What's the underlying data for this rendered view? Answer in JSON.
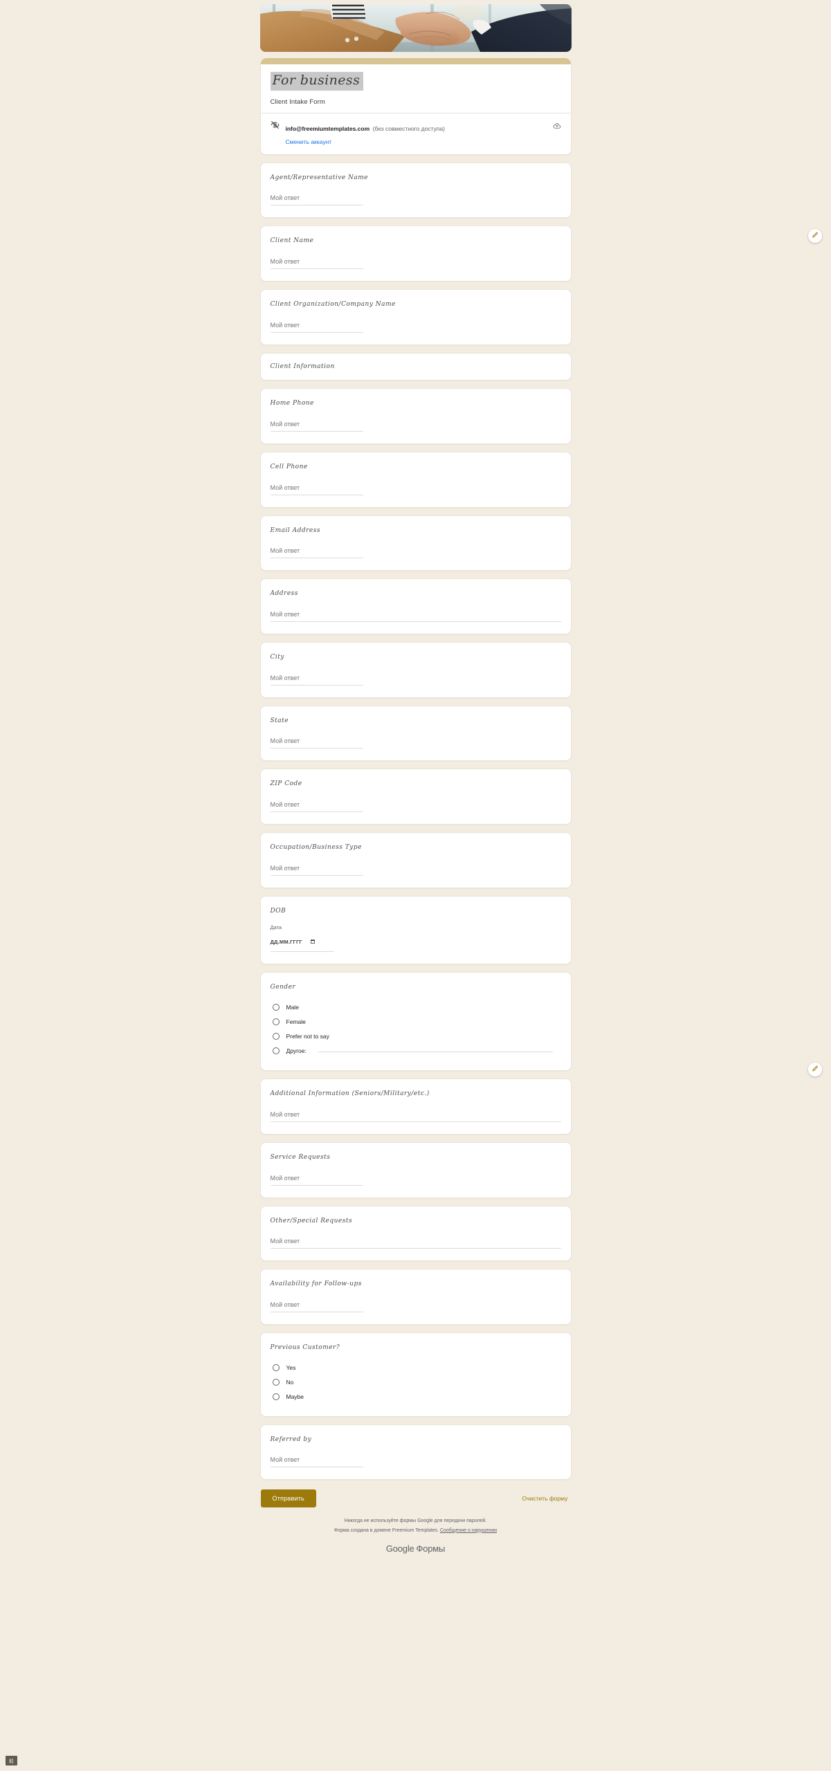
{
  "banner": {
    "alt": "business-handshake-banner"
  },
  "header": {
    "title": "For business",
    "subtitle": "Client Intake Form",
    "account": {
      "email": "info@freemiumtemplates.com",
      "shared_note": "(без совместного доступа)",
      "switch_label": "Сменить аккаунт",
      "visibility_icon": "eye-off-icon",
      "cloud_icon": "cloud-upload-icon"
    }
  },
  "common": {
    "answer_placeholder": "Мой ответ",
    "other_label": "Другое:"
  },
  "questions": [
    {
      "id": "agent-name",
      "label": "Agent/Representative Name",
      "type": "short_text",
      "width": "short"
    },
    {
      "id": "client-name",
      "label": "Client Name",
      "type": "short_text",
      "width": "short"
    },
    {
      "id": "client-org",
      "label": "Client Organization/Company Name",
      "type": "short_text",
      "width": "short"
    },
    {
      "id": "client-information",
      "label": "Client Information",
      "type": "section"
    },
    {
      "id": "home-phone",
      "label": "Home Phone",
      "type": "short_text",
      "width": "short"
    },
    {
      "id": "cell-phone",
      "label": "Cell Phone",
      "type": "short_text",
      "width": "short"
    },
    {
      "id": "email-address",
      "label": "Email Address",
      "type": "short_text",
      "width": "short"
    },
    {
      "id": "address",
      "label": "Address",
      "type": "short_text",
      "width": "wide"
    },
    {
      "id": "city",
      "label": "City",
      "type": "short_text",
      "width": "short"
    },
    {
      "id": "state",
      "label": "State",
      "type": "short_text",
      "width": "short"
    },
    {
      "id": "zip-code",
      "label": "ZIP Code",
      "type": "short_text",
      "width": "short"
    },
    {
      "id": "occupation",
      "label": "Occupation/Business Type",
      "type": "short_text",
      "width": "short"
    },
    {
      "id": "dob",
      "label": "DOB",
      "type": "date",
      "date_sublabel": "Дата",
      "date_placeholder": "ДД.ММ.ГГГГ"
    },
    {
      "id": "gender",
      "label": "Gender",
      "type": "radio",
      "options": [
        "Male",
        "Female",
        "Prefer not to say"
      ],
      "has_other": true
    },
    {
      "id": "additional-info",
      "label": "Additional Information (Seniors/Military/etc.)",
      "type": "short_text",
      "width": "wide"
    },
    {
      "id": "service-requests",
      "label": "Service Requests",
      "type": "short_text",
      "width": "short"
    },
    {
      "id": "other-special-requests",
      "label": "Other/Special Requests",
      "type": "short_text",
      "width": "wide"
    },
    {
      "id": "availability-followups",
      "label": "Availability for Follow-ups",
      "type": "short_text",
      "width": "short"
    },
    {
      "id": "previous-customer",
      "label": "Previous Customer?",
      "type": "radio",
      "options": [
        "Yes",
        "No",
        "Maybe"
      ],
      "has_other": false
    },
    {
      "id": "referred-by",
      "label": "Referred by",
      "type": "short_text",
      "width": "short"
    }
  ],
  "actions": {
    "submit_label": "Отправить",
    "clear_label": "Очистить форму"
  },
  "footer": {
    "password_warning": "Никогда не используйте формы Google для передачи паролей.",
    "domain_note": "Форма создана в домене Freemium Templates.",
    "report_link": "Сообщение о нарушении",
    "logo_google": "Google",
    "logo_forms": "Формы"
  },
  "fabs": {
    "edit_icon": "pencil-edit-icon"
  },
  "colors": {
    "page_bg": "#f2ece1",
    "accent_bar": "#d8c493",
    "submit_bg": "#9d7a0c",
    "link_blue": "#1a73e8",
    "clear_link": "#9d7a0c"
  }
}
